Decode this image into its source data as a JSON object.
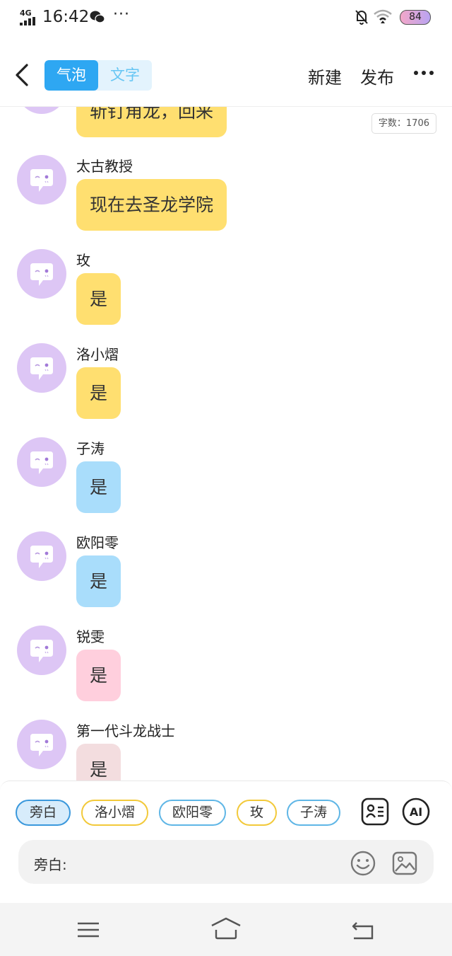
{
  "status_bar": {
    "network": "4G",
    "time": "16:42",
    "more": "···",
    "battery": "84"
  },
  "header": {
    "tabs": [
      "气泡",
      "文字"
    ],
    "new_label": "新建",
    "publish_label": "发布"
  },
  "word_count": "字数：1706",
  "partial_top_message": {
    "text": "斩钉角龙，回来",
    "bubble_color": "#ffdf70"
  },
  "messages": [
    {
      "name": "太古教授",
      "text": "现在去圣龙学院",
      "bubble_color": "#ffdf70"
    },
    {
      "name": "玫",
      "text": "是",
      "bubble_color": "#ffdf70"
    },
    {
      "name": "洛小熠",
      "text": "是",
      "bubble_color": "#ffdf70"
    },
    {
      "name": "子涛",
      "text": "是",
      "bubble_color": "#a9ddfb"
    },
    {
      "name": "欧阳零",
      "text": "是",
      "bubble_color": "#a9ddfb"
    },
    {
      "name": "锐雯",
      "text": "是",
      "bubble_color": "#ffcfdd"
    },
    {
      "name": "第一代斗龙战士",
      "text": "是",
      "bubble_color": "#f3dddf"
    }
  ],
  "role_chips": [
    {
      "label": "旁白",
      "border": "#3a98dc",
      "fill": "#d7ecfb"
    },
    {
      "label": "洛小熠",
      "border": "#f2c93a",
      "fill": "#ffffff"
    },
    {
      "label": "欧阳零",
      "border": "#5fb6e6",
      "fill": "#ffffff"
    },
    {
      "label": "玫",
      "border": "#f2c93a",
      "fill": "#ffffff"
    },
    {
      "label": "子涛",
      "border": "#5fb6e6",
      "fill": "#ffffff"
    }
  ],
  "ai_label": "AI",
  "input": {
    "label": "旁白:"
  },
  "colors": {
    "accent": "#2ea7f2",
    "avatar": "#ddc6f5"
  }
}
